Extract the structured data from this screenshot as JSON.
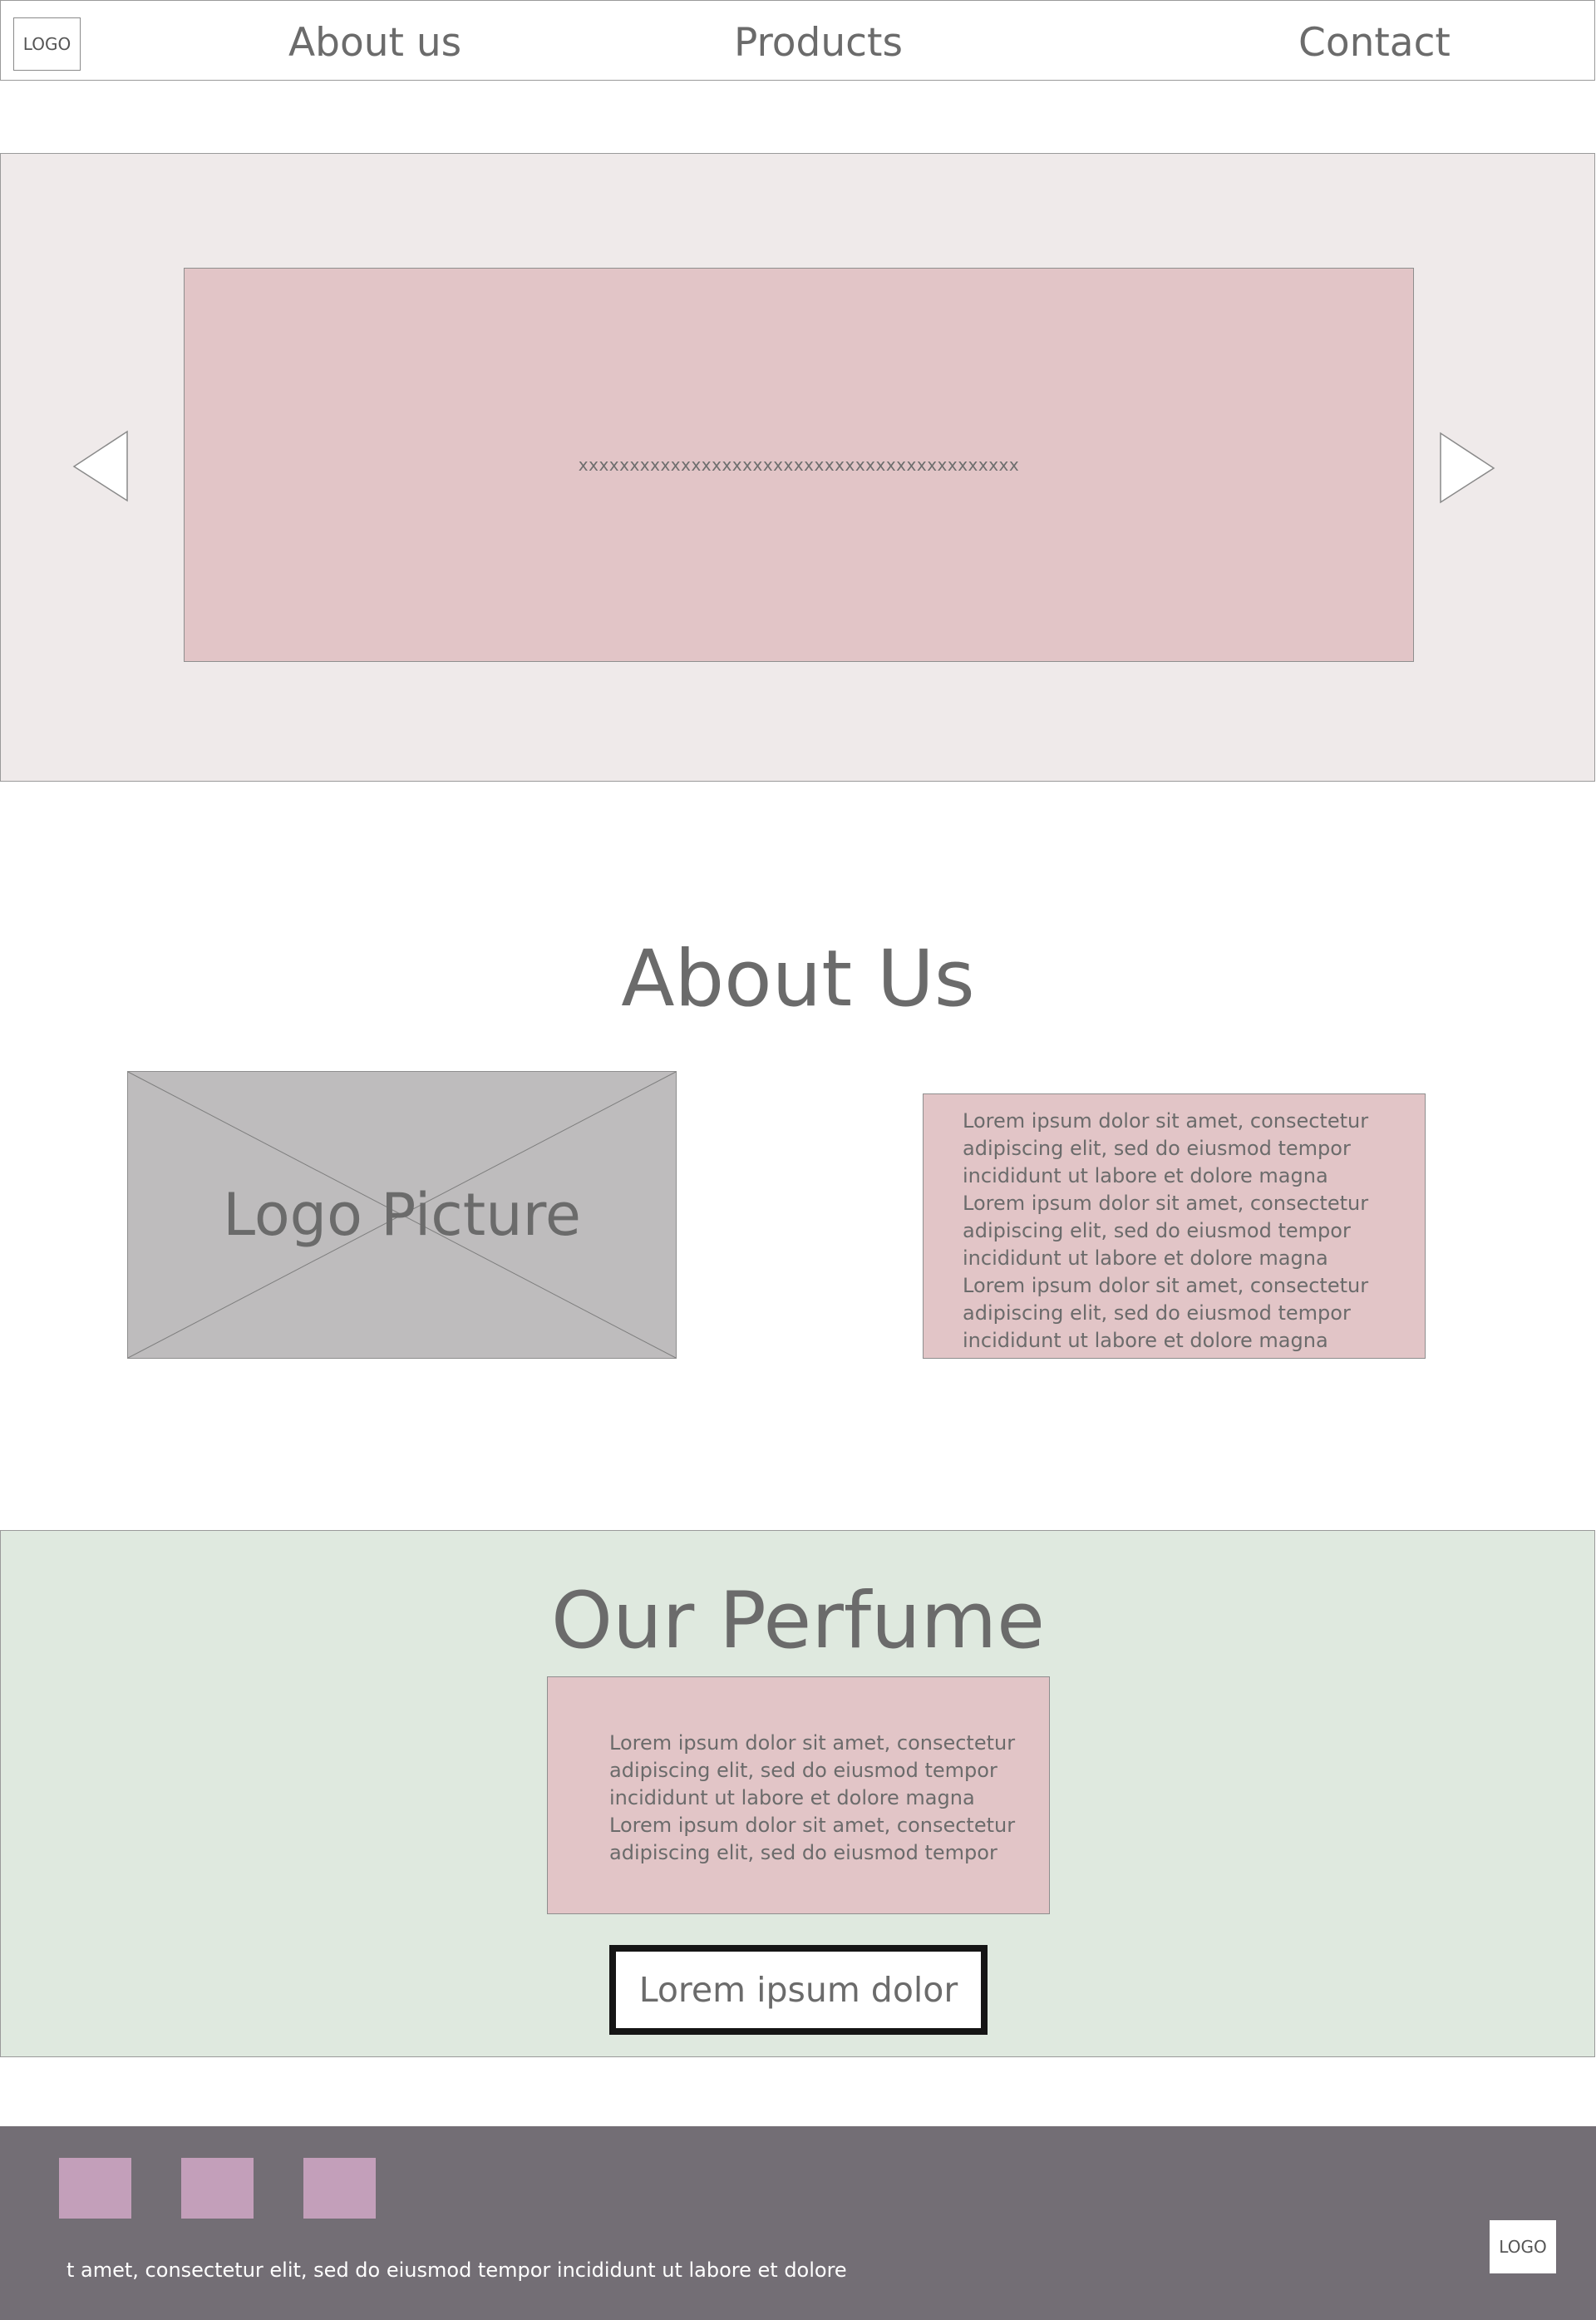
{
  "header": {
    "logo": "LOGO",
    "nav": [
      "About us",
      "Products",
      "Contact"
    ]
  },
  "hero": {
    "slide_text": "xxxxxxxxxxxxxxxxxxxxxxxxxxxxxxxxxxxxxxxxxxx",
    "prev_icon": "triangle-left-icon",
    "next_icon": "triangle-right-icon"
  },
  "about": {
    "title": "About Us",
    "image_label": "Logo Picture",
    "text_lines": [
      "Lorem ipsum dolor sit amet, consectetur",
      "adipiscing elit, sed do eiusmod tempor",
      "incididunt ut labore et dolore magna",
      "Lorem ipsum dolor sit amet, consectetur",
      "adipiscing elit, sed do eiusmod tempor",
      "incididunt ut labore et dolore magna",
      "Lorem ipsum dolor sit amet, consectetur",
      "adipiscing elit, sed do eiusmod tempor",
      "incididunt ut labore et dolore magna"
    ]
  },
  "perfume": {
    "title": "Our Perfume",
    "text_lines": [
      "Lorem ipsum dolor sit amet, consectetur",
      "adipiscing elit, sed do eiusmod tempor",
      "incididunt ut labore et dolore magna",
      "Lorem ipsum dolor sit amet, consectetur",
      "adipiscing elit, sed do eiusmod tempor"
    ],
    "button_label": "Lorem ipsum dolor"
  },
  "footer": {
    "text": "t amet, consectetur elit, sed do eiusmod tempor incididunt ut labore et dolore",
    "logo": "LOGO"
  },
  "colors": {
    "hero_bg": "#efeaea",
    "pink_box": "#e2c5c7",
    "image_placeholder": "#bebcbd",
    "perfume_bg": "#dfe9df",
    "footer_bg": "#736e75",
    "social_square": "#c39fba"
  }
}
